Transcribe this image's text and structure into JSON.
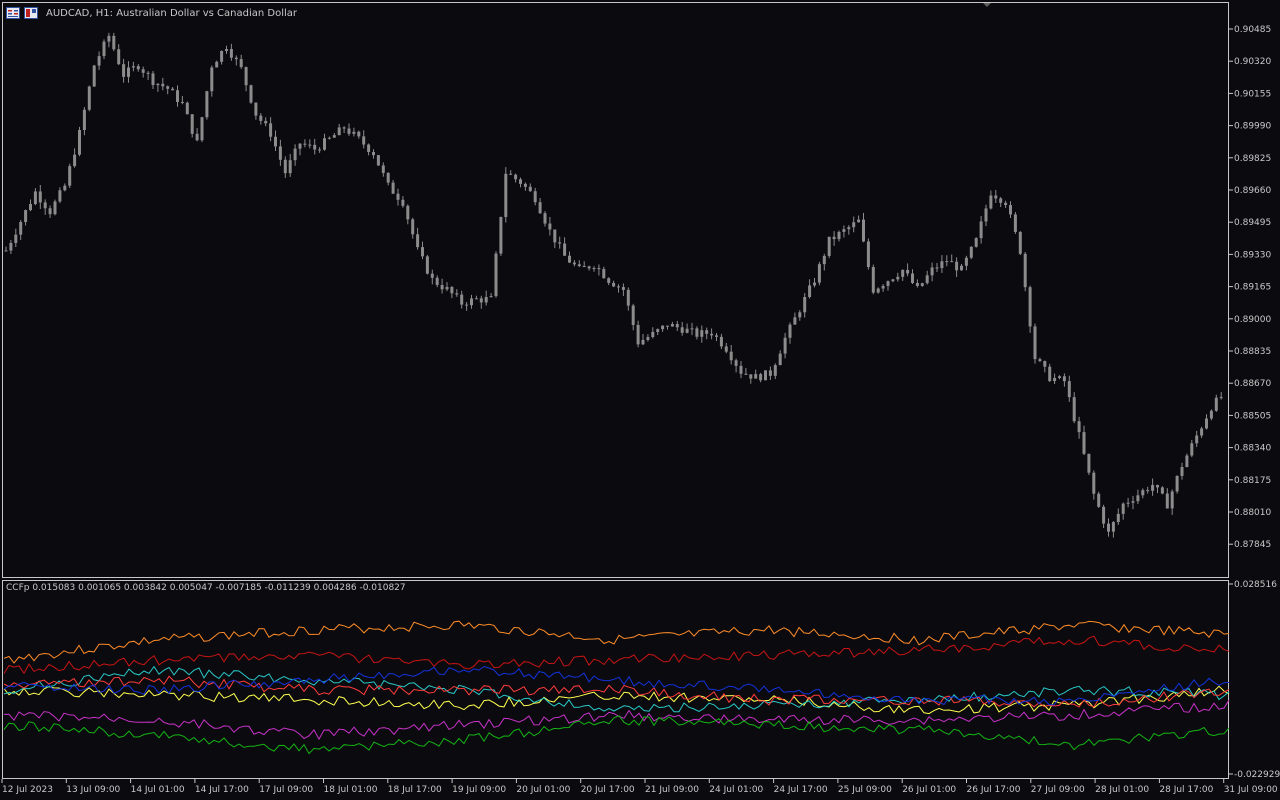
{
  "header": {
    "symbol": "AUDCAD",
    "timeframe": "H1:",
    "description": "Australian Dollar vs Canadian  Dollar",
    "menu_icon": "chart-menu-icon",
    "window_icon": "window-toggle-icon"
  },
  "price_axis": {
    "labels": [
      "0.90485",
      "0.90320",
      "0.90155",
      "0.89990",
      "0.89825",
      "0.89660",
      "0.89495",
      "0.89330",
      "0.89165",
      "0.89000",
      "0.88835",
      "0.88670",
      "0.88505",
      "0.88340",
      "0.88175",
      "0.88010",
      "0.87845"
    ],
    "ylim": [
      0.8775,
      0.9056
    ]
  },
  "indicator": {
    "label": "CCFp 0.015083 0.001065 0.003842 0.005047 -0.007185 -0.011239 0.004286 -0.010827",
    "axis_top": "0.028516",
    "axis_bottom": "-0.022929"
  },
  "time_axis": {
    "labels": [
      "12 Jul 2023",
      "13 Jul 09:00",
      "14 Jul 01:00",
      "14 Jul 17:00",
      "17 Jul 09:00",
      "18 Jul 01:00",
      "18 Jul 17:00",
      "19 Jul 09:00",
      "20 Jul 01:00",
      "20 Jul 17:00",
      "21 Jul 09:00",
      "24 Jul 01:00",
      "24 Jul 17:00",
      "25 Jul 09:00",
      "26 Jul 01:00",
      "26 Jul 17:00",
      "27 Jul 09:00",
      "28 Jul 01:00",
      "28 Jul 17:00",
      "31 Jul 09:00"
    ]
  },
  "colors": {
    "background": "#0b0b0f",
    "grid_border": "#c8c8c8",
    "candle": "#8c8c8c",
    "text": "#c8c8c8",
    "ccf_lines": [
      "#ff8c28",
      "#c81414",
      "#ffff50",
      "#28c8c8",
      "#ff3c3c",
      "#1432dc",
      "#c832c8",
      "#14b414"
    ]
  },
  "chart_data": {
    "type": "candlestick",
    "title": "AUDCAD, H1:  Australian Dollar vs Canadian  Dollar",
    "xlabel": "",
    "ylabel": "",
    "ylim": [
      0.8775,
      0.9056
    ],
    "close_path": [
      [
        0,
        0.8935
      ],
      [
        3,
        0.895
      ],
      [
        6,
        0.8965
      ],
      [
        9,
        0.8955
      ],
      [
        12,
        0.8968
      ],
      [
        15,
        0.8995
      ],
      [
        18,
        0.903
      ],
      [
        21,
        0.9045
      ],
      [
        24,
        0.9025
      ],
      [
        27,
        0.903
      ],
      [
        30,
        0.9022
      ],
      [
        33,
        0.9018
      ],
      [
        36,
        0.901
      ],
      [
        39,
        0.899
      ],
      [
        42,
        0.903
      ],
      [
        45,
        0.904
      ],
      [
        48,
        0.9028
      ],
      [
        51,
        0.9005
      ],
      [
        54,
        0.8995
      ],
      [
        57,
        0.8975
      ],
      [
        60,
        0.899
      ],
      [
        63,
        0.8987
      ],
      [
        66,
        0.8992
      ],
      [
        69,
        0.8998
      ],
      [
        72,
        0.8992
      ],
      [
        75,
        0.8985
      ],
      [
        78,
        0.8968
      ],
      [
        81,
        0.896
      ],
      [
        84,
        0.8935
      ],
      [
        87,
        0.892
      ],
      [
        90,
        0.8915
      ],
      [
        93,
        0.8908
      ],
      [
        96,
        0.891
      ],
      [
        99,
        0.891
      ],
      [
        102,
        0.8975
      ],
      [
        105,
        0.897
      ],
      [
        108,
        0.8962
      ],
      [
        111,
        0.8945
      ],
      [
        114,
        0.8932
      ],
      [
        117,
        0.8925
      ],
      [
        120,
        0.8928
      ],
      [
        123,
        0.892
      ],
      [
        126,
        0.8915
      ],
      [
        129,
        0.8888
      ],
      [
        132,
        0.8892
      ],
      [
        135,
        0.8897
      ],
      [
        138,
        0.8895
      ],
      [
        141,
        0.8892
      ],
      [
        144,
        0.8893
      ],
      [
        147,
        0.8885
      ],
      [
        150,
        0.8873
      ],
      [
        153,
        0.887
      ],
      [
        156,
        0.8872
      ],
      [
        159,
        0.889
      ],
      [
        162,
        0.8905
      ],
      [
        165,
        0.892
      ],
      [
        168,
        0.894
      ],
      [
        171,
        0.8945
      ],
      [
        174,
        0.895
      ],
      [
        177,
        0.8915
      ],
      [
        180,
        0.892
      ],
      [
        183,
        0.8925
      ],
      [
        186,
        0.8915
      ],
      [
        189,
        0.8925
      ],
      [
        192,
        0.893
      ],
      [
        195,
        0.8925
      ],
      [
        198,
        0.894
      ],
      [
        201,
        0.8965
      ],
      [
        204,
        0.896
      ],
      [
        207,
        0.8935
      ],
      [
        210,
        0.888
      ],
      [
        213,
        0.887
      ],
      [
        216,
        0.8868
      ],
      [
        219,
        0.884
      ],
      [
        222,
        0.881
      ],
      [
        225,
        0.879
      ],
      [
        228,
        0.8805
      ],
      [
        231,
        0.881
      ],
      [
        234,
        0.8815
      ],
      [
        237,
        0.8805
      ],
      [
        240,
        0.8825
      ],
      [
        243,
        0.884
      ],
      [
        246,
        0.8855
      ],
      [
        248,
        0.886
      ]
    ]
  }
}
